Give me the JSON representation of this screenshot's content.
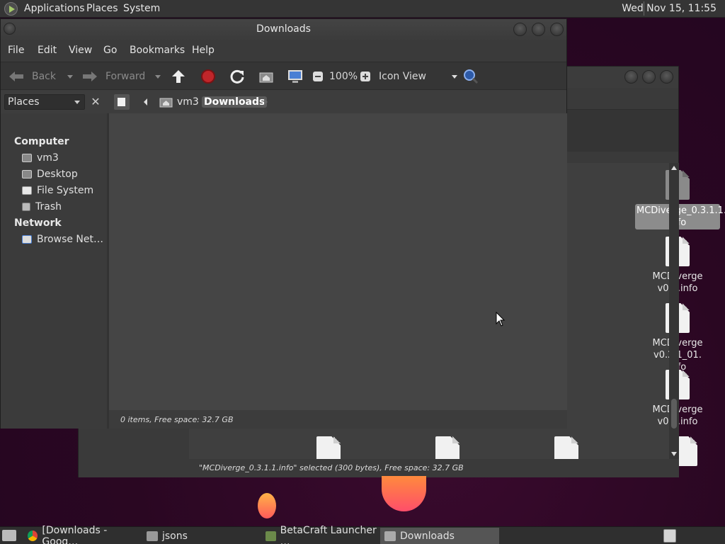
{
  "top_panel": {
    "menus": [
      "Applications",
      "Places",
      "System"
    ],
    "clock": "Wed Nov 15, 11:55"
  },
  "window": {
    "title": "Downloads",
    "menu": [
      "File",
      "Edit",
      "View",
      "Go",
      "Bookmarks",
      "Help"
    ],
    "toolbar": {
      "back": "Back",
      "forward": "Forward",
      "zoom": "100%",
      "view_mode": "Icon View"
    },
    "sidebar_selector": "Places",
    "breadcrumbs": [
      "vm3",
      "Downloads"
    ],
    "sidebar": {
      "sections": [
        {
          "heading": "Computer",
          "items": [
            "vm3",
            "Desktop",
            "File System",
            "Trash"
          ]
        },
        {
          "heading": "Network",
          "items": [
            "Browse Net…"
          ]
        }
      ]
    },
    "status": "0 items, Free space: 32.7 GB"
  },
  "background_window": {
    "files": [
      {
        "name": "MCDiverge_0.3.1.1.\ninfo",
        "selected": true
      },
      {
        "name": "MCDiverge v0.1.info",
        "selected": false
      },
      {
        "name": "MCDiverge v0.2.1_01.\ninfo",
        "selected": false
      },
      {
        "name": "MCDiverge v0.2.info",
        "selected": false
      }
    ],
    "status": "\"MCDiverge_0.3.1.1.info\" selected (300 bytes), Free space: 32.7 GB"
  },
  "taskbar": {
    "tasks": [
      "[Downloads - Goog…",
      "jsons",
      "BetaCraft Launcher …",
      "Downloads"
    ],
    "active_task": "Downloads"
  },
  "colors": {
    "desktop": "#2a0722",
    "panel": "#353535",
    "window": "#3d3d3d",
    "stop_red": "#c0262a",
    "search_blue": "#4a7fd4"
  }
}
